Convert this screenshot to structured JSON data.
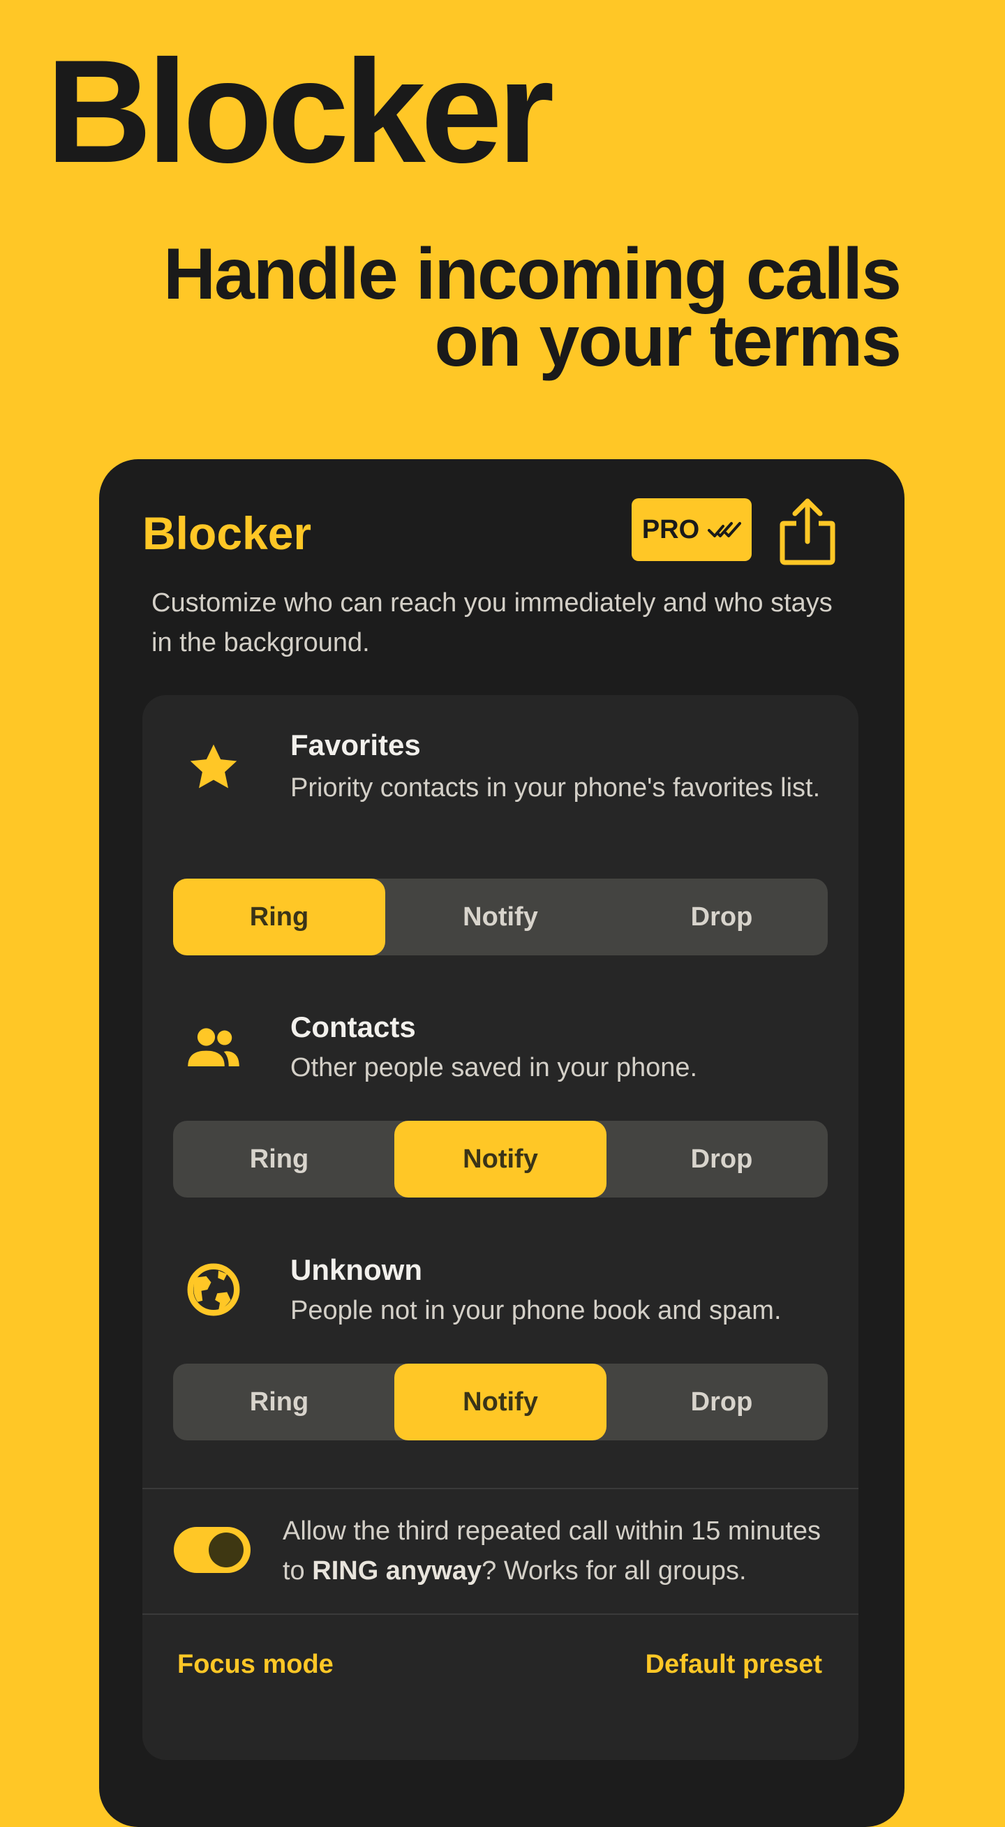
{
  "hero": {
    "title": "Blocker",
    "subtitle_line1": "Handle incoming calls",
    "subtitle_line2": "on your terms"
  },
  "app": {
    "title": "Blocker",
    "pro_label": "PRO",
    "description": "Customize who can reach you immediately and who stays in the background."
  },
  "options": [
    "Ring",
    "Notify",
    "Drop"
  ],
  "groups": [
    {
      "name": "Favorites",
      "description": "Priority contacts in your phone's favorites list.",
      "icon": "star-icon",
      "selected": "Ring"
    },
    {
      "name": "Contacts",
      "description": "Other people saved in your phone.",
      "icon": "people-icon",
      "selected": "Notify"
    },
    {
      "name": "Unknown",
      "description": "People not in your phone book and spam.",
      "icon": "globe-icon",
      "selected": "Notify"
    }
  ],
  "repeat_call": {
    "enabled": true,
    "text_before": "Allow the third repeated call within 15 minutes to ",
    "text_bold": "RING anyway",
    "text_after": "? Works for all groups."
  },
  "footer": {
    "left_link": "Focus mode",
    "right_link": "Default preset"
  },
  "colors": {
    "accent": "#FFC726",
    "background_dark": "#1C1C1C",
    "card": "#262626",
    "segment": "#444441"
  }
}
